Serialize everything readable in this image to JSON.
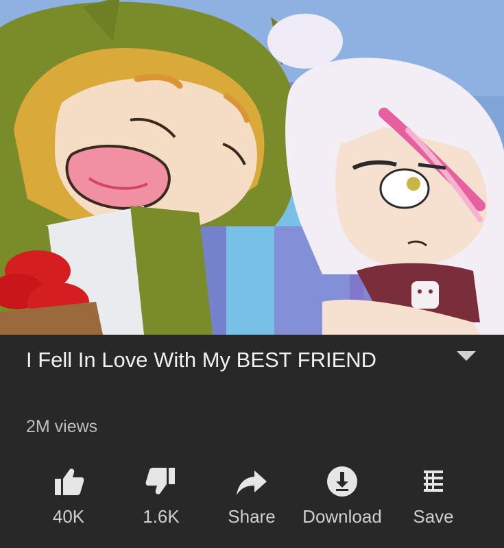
{
  "video": {
    "title": "I Fell In Love With My BEST FRIEND",
    "views": "2M views"
  },
  "actions": {
    "like_count": "40K",
    "dislike_count": "1.6K",
    "share_label": "Share",
    "download_label": "Download",
    "save_label": "Save"
  },
  "icons": {
    "like": "thumbs-up-icon",
    "dislike": "thumbs-down-icon",
    "share": "share-arrow-icon",
    "download": "download-icon",
    "save": "save-playlist-icon",
    "expand": "chevron-down-icon"
  },
  "colors": {
    "background": "#282828",
    "text_primary": "#f1f1f1",
    "text_secondary": "#bdbdbd",
    "icon": "#e6e6e6"
  }
}
